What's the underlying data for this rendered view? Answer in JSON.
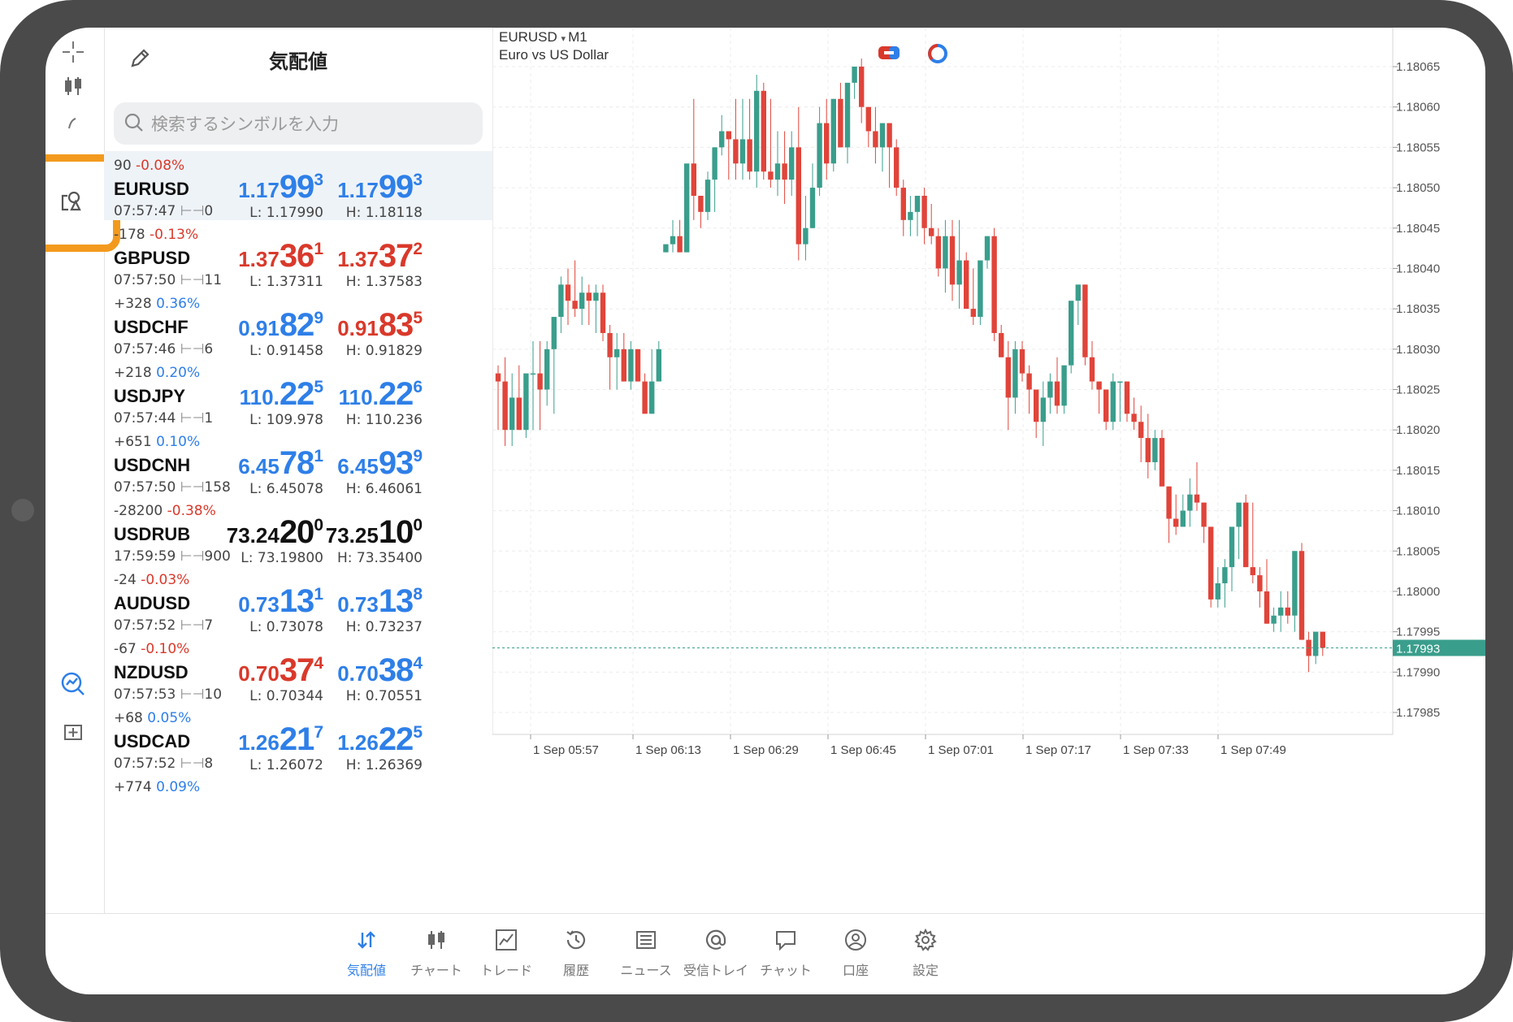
{
  "quotes": {
    "title": "気配値",
    "search_placeholder": "検索するシンボルを入力",
    "rows": [
      {
        "change_pts": "90",
        "change_pct": "-0.08%",
        "symbol": "EURUSD",
        "time": "07:57:47",
        "spread": "0",
        "bid_small": "1.17",
        "bid_big": "99",
        "bid_tail": "3",
        "ask_small": "1.17",
        "ask_big": "99",
        "ask_tail": "3",
        "low": "L: 1.17990",
        "high": "H: 1.18118",
        "bid_color": "blue",
        "ask_color": "blue",
        "pct_color": "red"
      },
      {
        "change_pts": "-178",
        "change_pct": "-0.13%",
        "symbol": "GBPUSD",
        "time": "07:57:50",
        "spread": "11",
        "bid_small": "1.37",
        "bid_big": "36",
        "bid_tail": "1",
        "ask_small": "1.37",
        "ask_big": "37",
        "ask_tail": "2",
        "low": "L: 1.37311",
        "high": "H: 1.37583",
        "bid_color": "red",
        "ask_color": "red",
        "pct_color": "red"
      },
      {
        "change_pts": "+328",
        "change_pct": "0.36%",
        "symbol": "USDCHF",
        "time": "07:57:46",
        "spread": "6",
        "bid_small": "0.91",
        "bid_big": "82",
        "bid_tail": "9",
        "ask_small": "0.91",
        "ask_big": "83",
        "ask_tail": "5",
        "low": "L: 0.91458",
        "high": "H: 0.91829",
        "bid_color": "blue",
        "ask_color": "red",
        "pct_color": "blue"
      },
      {
        "change_pts": "+218",
        "change_pct": "0.20%",
        "symbol": "USDJPY",
        "time": "07:57:44",
        "spread": "1",
        "bid_small": "110.",
        "bid_big": "22",
        "bid_tail": "5",
        "ask_small": "110.",
        "ask_big": "22",
        "ask_tail": "6",
        "low": "L: 109.978",
        "high": "H: 110.236",
        "bid_color": "blue",
        "ask_color": "blue",
        "pct_color": "blue"
      },
      {
        "change_pts": "+651",
        "change_pct": "0.10%",
        "symbol": "USDCNH",
        "time": "07:57:50",
        "spread": "158",
        "bid_small": "6.45",
        "bid_big": "78",
        "bid_tail": "1",
        "ask_small": "6.45",
        "ask_big": "93",
        "ask_tail": "9",
        "low": "L: 6.45078",
        "high": "H: 6.46061",
        "bid_color": "blue",
        "ask_color": "blue",
        "pct_color": "blue"
      },
      {
        "change_pts": "-28200",
        "change_pct": "-0.38%",
        "symbol": "USDRUB",
        "time": "17:59:59",
        "spread": "900",
        "bid_small": "73.24",
        "bid_big": "20",
        "bid_tail": "0",
        "ask_small": "73.25",
        "ask_big": "10",
        "ask_tail": "0",
        "low": "L: 73.19800",
        "high": "H: 73.35400",
        "bid_color": "blk",
        "ask_color": "blk",
        "pct_color": "red"
      },
      {
        "change_pts": "-24",
        "change_pct": "-0.03%",
        "symbol": "AUDUSD",
        "time": "07:57:52",
        "spread": "7",
        "bid_small": "0.73",
        "bid_big": "13",
        "bid_tail": "1",
        "ask_small": "0.73",
        "ask_big": "13",
        "ask_tail": "8",
        "low": "L: 0.73078",
        "high": "H: 0.73237",
        "bid_color": "blue",
        "ask_color": "blue",
        "pct_color": "red"
      },
      {
        "change_pts": "-67",
        "change_pct": "-0.10%",
        "symbol": "NZDUSD",
        "time": "07:57:53",
        "spread": "10",
        "bid_small": "0.70",
        "bid_big": "37",
        "bid_tail": "4",
        "ask_small": "0.70",
        "ask_big": "38",
        "ask_tail": "4",
        "low": "L: 0.70344",
        "high": "H: 0.70551",
        "bid_color": "red",
        "ask_color": "blue",
        "pct_color": "red"
      },
      {
        "change_pts": "+68",
        "change_pct": "0.05%",
        "symbol": "USDCAD",
        "time": "07:57:52",
        "spread": "8",
        "bid_small": "1.26",
        "bid_big": "21",
        "bid_tail": "7",
        "ask_small": "1.26",
        "ask_big": "22",
        "ask_tail": "5",
        "low": "L: 1.26072",
        "high": "H: 1.26369",
        "bid_color": "blue",
        "ask_color": "blue",
        "pct_color": "blue"
      },
      {
        "change_pts": "+774",
        "change_pct": "0.09%",
        "symbol": "",
        "time": "",
        "spread": "",
        "bid_small": "",
        "bid_big": "",
        "bid_tail": "",
        "ask_small": "",
        "ask_big": "",
        "ask_tail": "",
        "low": "",
        "high": "",
        "bid_color": "blue",
        "ask_color": "blue",
        "pct_color": "blue"
      }
    ]
  },
  "chart": {
    "symbol": "EURUSD",
    "timeframe": "M1",
    "description": "Euro vs US Dollar",
    "current_price": "1.17993",
    "price_labels": [
      "1.18065",
      "1.18060",
      "1.18055",
      "1.18050",
      "1.18045",
      "1.18040",
      "1.18035",
      "1.18030",
      "1.18025",
      "1.18020",
      "1.18015",
      "1.18010",
      "1.18005",
      "1.18000",
      "1.17995",
      "1.17990",
      "1.17985"
    ],
    "time_labels": [
      "1 Sep 05:57",
      "1 Sep 06:13",
      "1 Sep 06:29",
      "1 Sep 06:45",
      "1 Sep 07:01",
      "1 Sep 07:17",
      "1 Sep 07:33",
      "1 Sep 07:49"
    ],
    "up_color": "#3a9e8c",
    "down_color": "#e0443a"
  },
  "chart_data": {
    "type": "candlestick",
    "ylim": [
      1.17982,
      1.18068
    ],
    "candles": [
      [
        1.18027,
        1.18028,
        1.1802,
        1.18026
      ],
      [
        1.18026,
        1.18029,
        1.18018,
        1.1802
      ],
      [
        1.1802,
        1.18027,
        1.18018,
        1.18024
      ],
      [
        1.18024,
        1.18028,
        1.18022,
        1.1802
      ],
      [
        1.1802,
        1.18027,
        1.18019,
        1.18027
      ],
      [
        1.18027,
        1.18031,
        1.1802,
        1.18027
      ],
      [
        1.18027,
        1.18031,
        1.1802,
        1.18025
      ],
      [
        1.18025,
        1.18031,
        1.18023,
        1.1803
      ],
      [
        1.1803,
        1.18034,
        1.18022,
        1.18034
      ],
      [
        1.18034,
        1.18039,
        1.18032,
        1.18038
      ],
      [
        1.18038,
        1.1804,
        1.18033,
        1.18036
      ],
      [
        1.18036,
        1.18041,
        1.18034,
        1.18035
      ],
      [
        1.18035,
        1.18039,
        1.18033,
        1.18037
      ],
      [
        1.18037,
        1.18038,
        1.18033,
        1.18036
      ],
      [
        1.18036,
        1.18038,
        1.18032,
        1.18037
      ],
      [
        1.18037,
        1.18038,
        1.18031,
        1.18032
      ],
      [
        1.18032,
        1.18033,
        1.18025,
        1.18029
      ],
      [
        1.18029,
        1.18032,
        1.18025,
        1.1803
      ],
      [
        1.1803,
        1.18032,
        1.18026,
        1.18026
      ],
      [
        1.18026,
        1.18031,
        1.18025,
        1.1803
      ],
      [
        1.1803,
        1.1803,
        1.18026,
        1.18026
      ],
      [
        1.18026,
        1.18027,
        1.18022,
        1.18022
      ],
      [
        1.18022,
        1.1803,
        1.18022,
        1.18026
      ],
      [
        1.18026,
        1.18031,
        1.18026,
        1.1803
      ],
      [
        1.18042,
        1.18043,
        1.18042,
        1.18043
      ],
      [
        1.18043,
        1.18046,
        1.18042,
        1.18044
      ],
      [
        1.18044,
        1.18046,
        1.18042,
        1.18042
      ],
      [
        1.18042,
        1.18049,
        1.18042,
        1.18053
      ],
      [
        1.18053,
        1.18061,
        1.18046,
        1.18049
      ],
      [
        1.18049,
        1.18049,
        1.18045,
        1.18047
      ],
      [
        1.18047,
        1.18052,
        1.18046,
        1.18051
      ],
      [
        1.18051,
        1.18055,
        1.18047,
        1.18055
      ],
      [
        1.18055,
        1.18059,
        1.18054,
        1.18057
      ],
      [
        1.18057,
        1.18057,
        1.18051,
        1.18056
      ],
      [
        1.18056,
        1.18061,
        1.18051,
        1.18053
      ],
      [
        1.18053,
        1.18061,
        1.18051,
        1.18056
      ],
      [
        1.18056,
        1.18061,
        1.18051,
        1.18052
      ],
      [
        1.18052,
        1.18064,
        1.1805,
        1.18062
      ],
      [
        1.18062,
        1.18063,
        1.18051,
        1.18052
      ],
      [
        1.18052,
        1.18061,
        1.1805,
        1.18051
      ],
      [
        1.18051,
        1.18057,
        1.18049,
        1.18053
      ],
      [
        1.18053,
        1.18057,
        1.18048,
        1.18051
      ],
      [
        1.18051,
        1.18057,
        1.18049,
        1.18055
      ],
      [
        1.18055,
        1.1806,
        1.18041,
        1.18043
      ],
      [
        1.18043,
        1.18049,
        1.18041,
        1.18045
      ],
      [
        1.18045,
        1.18053,
        1.18045,
        1.1805
      ],
      [
        1.1805,
        1.1806,
        1.18049,
        1.18058
      ],
      [
        1.18058,
        1.18061,
        1.18051,
        1.18053
      ],
      [
        1.18053,
        1.18061,
        1.18052,
        1.18061
      ],
      [
        1.18061,
        1.18063,
        1.18055,
        1.18055
      ],
      [
        1.18055,
        1.18062,
        1.18053,
        1.18063
      ],
      [
        1.18063,
        1.18065,
        1.18061,
        1.18065
      ],
      [
        1.18065,
        1.18066,
        1.18058,
        1.1806
      ],
      [
        1.1806,
        1.1806,
        1.18055,
        1.18057
      ],
      [
        1.18057,
        1.1806,
        1.18053,
        1.18055
      ],
      [
        1.18055,
        1.18058,
        1.18052,
        1.18058
      ],
      [
        1.18058,
        1.18058,
        1.1805,
        1.18055
      ],
      [
        1.18055,
        1.18056,
        1.18049,
        1.1805
      ],
      [
        1.1805,
        1.18051,
        1.18044,
        1.18046
      ],
      [
        1.18046,
        1.18049,
        1.18044,
        1.18047
      ],
      [
        1.18047,
        1.18049,
        1.18044,
        1.18049
      ],
      [
        1.18049,
        1.1805,
        1.18043,
        1.18045
      ],
      [
        1.18045,
        1.18048,
        1.18043,
        1.18044
      ],
      [
        1.18044,
        1.18045,
        1.18039,
        1.1804
      ],
      [
        1.1804,
        1.18046,
        1.18037,
        1.18044
      ],
      [
        1.18044,
        1.18046,
        1.18036,
        1.18038
      ],
      [
        1.18038,
        1.18046,
        1.18035,
        1.18041
      ],
      [
        1.18041,
        1.18042,
        1.18035,
        1.18035
      ],
      [
        1.18035,
        1.1804,
        1.18033,
        1.18034
      ],
      [
        1.18034,
        1.1804,
        1.18033,
        1.18041
      ],
      [
        1.18041,
        1.18044,
        1.1804,
        1.18044
      ],
      [
        1.18044,
        1.18045,
        1.18031,
        1.18032
      ],
      [
        1.18032,
        1.18033,
        1.18029,
        1.18029
      ],
      [
        1.18029,
        1.18031,
        1.1802,
        1.18024
      ],
      [
        1.18024,
        1.18031,
        1.18022,
        1.1803
      ],
      [
        1.1803,
        1.18031,
        1.18026,
        1.18027
      ],
      [
        1.18027,
        1.18028,
        1.18022,
        1.18025
      ],
      [
        1.18025,
        1.18025,
        1.18019,
        1.18021
      ],
      [
        1.18021,
        1.18026,
        1.18018,
        1.18024
      ],
      [
        1.18024,
        1.18027,
        1.18022,
        1.18026
      ],
      [
        1.18026,
        1.18029,
        1.18022,
        1.18023
      ],
      [
        1.18023,
        1.18028,
        1.18022,
        1.18028
      ],
      [
        1.18028,
        1.18035,
        1.18027,
        1.18036
      ],
      [
        1.18036,
        1.18038,
        1.18033,
        1.18038
      ],
      [
        1.18038,
        1.18038,
        1.18028,
        1.18029
      ],
      [
        1.18029,
        1.18031,
        1.18025,
        1.18026
      ],
      [
        1.18026,
        1.18026,
        1.18022,
        1.18025
      ],
      [
        1.18025,
        1.18025,
        1.1802,
        1.18021
      ],
      [
        1.18021,
        1.18027,
        1.1802,
        1.18026
      ],
      [
        1.18026,
        1.18026,
        1.18021,
        1.18026
      ],
      [
        1.18026,
        1.18026,
        1.18021,
        1.18022
      ],
      [
        1.18022,
        1.18024,
        1.1802,
        1.18021
      ],
      [
        1.18021,
        1.18023,
        1.18016,
        1.18019
      ],
      [
        1.18019,
        1.18022,
        1.18014,
        1.18016
      ],
      [
        1.18016,
        1.1802,
        1.18015,
        1.18019
      ],
      [
        1.18019,
        1.1802,
        1.18013,
        1.18013
      ],
      [
        1.18013,
        1.18013,
        1.18006,
        1.18009
      ],
      [
        1.18009,
        1.18012,
        1.18007,
        1.18008
      ],
      [
        1.18008,
        1.18012,
        1.18008,
        1.1801
      ],
      [
        1.1801,
        1.18014,
        1.18008,
        1.18012
      ],
      [
        1.18012,
        1.18016,
        1.1801,
        1.18011
      ],
      [
        1.18011,
        1.18011,
        1.18006,
        1.18008
      ],
      [
        1.18008,
        1.18008,
        1.17998,
        1.17999
      ],
      [
        1.17999,
        1.18003,
        1.17998,
        1.18001
      ],
      [
        1.18001,
        1.18004,
        1.17998,
        1.18003
      ],
      [
        1.18003,
        1.18007,
        1.18,
        1.18008
      ],
      [
        1.18008,
        1.1801,
        1.18004,
        1.18011
      ],
      [
        1.18011,
        1.18012,
        1.18003,
        1.18003
      ],
      [
        1.18003,
        1.18011,
        1.18001,
        1.18002
      ],
      [
        1.18002,
        1.18003,
        1.17998,
        1.18
      ],
      [
        1.18,
        1.18004,
        1.17996,
        1.17996
      ],
      [
        1.17996,
        1.17998,
        1.17995,
        1.17997
      ],
      [
        1.17997,
        1.18,
        1.17995,
        1.17998
      ],
      [
        1.17998,
        1.18,
        1.17996,
        1.17997
      ],
      [
        1.17997,
        1.18004,
        1.17995,
        1.18005
      ],
      [
        1.18005,
        1.18006,
        1.17994,
        1.17994
      ],
      [
        1.17994,
        1.17995,
        1.1799,
        1.17992
      ],
      [
        1.17992,
        1.17995,
        1.17991,
        1.17995
      ],
      [
        1.17995,
        1.17995,
        1.17992,
        1.17993
      ]
    ]
  },
  "nav": {
    "items": [
      {
        "label": "気配値",
        "icon": "quotes-icon",
        "active": true
      },
      {
        "label": "チャート",
        "icon": "chart-icon",
        "active": false
      },
      {
        "label": "トレード",
        "icon": "trade-icon",
        "active": false
      },
      {
        "label": "履歴",
        "icon": "history-icon",
        "active": false
      },
      {
        "label": "ニュース",
        "icon": "news-icon",
        "active": false
      },
      {
        "label": "受信トレイ",
        "icon": "mail-icon",
        "active": false
      },
      {
        "label": "チャット",
        "icon": "chat-icon",
        "active": false
      },
      {
        "label": "口座",
        "icon": "account-icon",
        "active": false
      },
      {
        "label": "設定",
        "icon": "settings-icon",
        "active": false
      }
    ]
  }
}
